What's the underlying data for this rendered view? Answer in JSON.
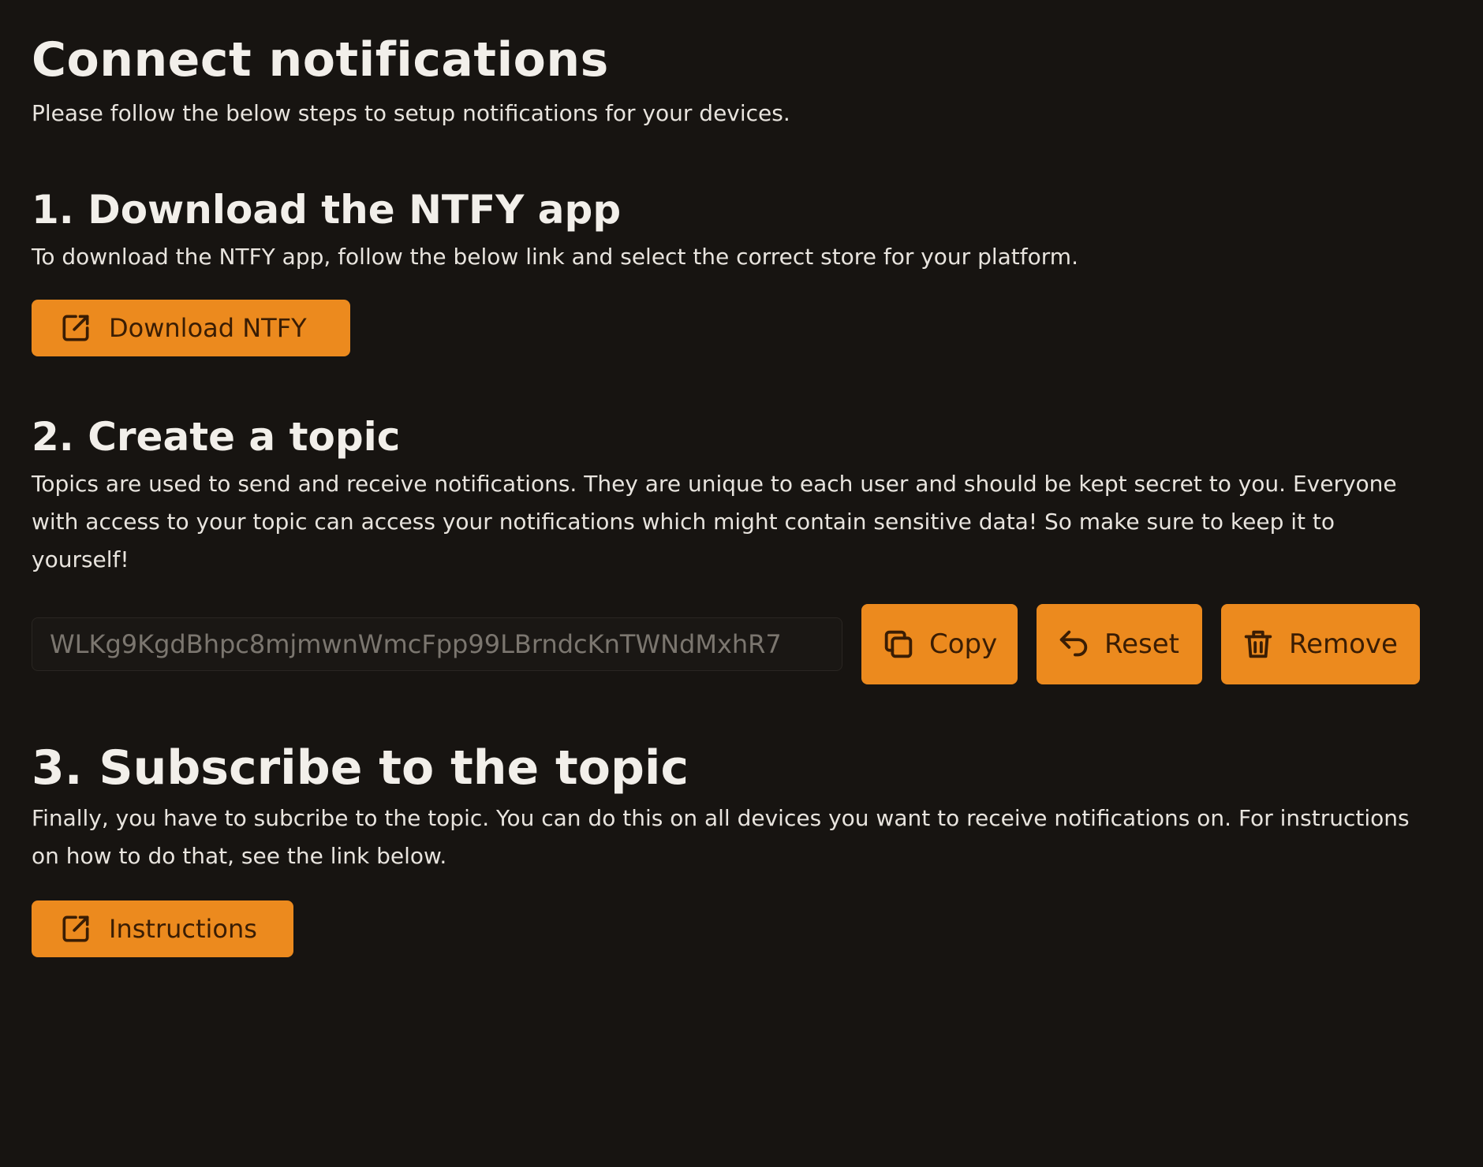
{
  "header": {
    "title": "Connect notifications",
    "subtitle": "Please follow the below steps to setup notifications for your devices."
  },
  "steps": [
    {
      "title": "1. Download the NTFY app",
      "text": "To download the NTFY app, follow the below link and select the correct store for your platform.",
      "button_label": "Download NTFY",
      "button_icon": "external-link-icon"
    },
    {
      "title": "2. Create a topic",
      "text": "Topics are used to send and receive notifications. They are unique to each user and should be kept secret to you. Everyone with access to your topic can access your notifications which might contain sensitive data! So make sure to keep it to yourself!",
      "topic_value": "WLKg9KgdBhpc8mjmwnWmcFpp99LBrndcKnTWNdMxhR7",
      "copy_label": "Copy",
      "reset_label": "Reset",
      "remove_label": "Remove"
    },
    {
      "title": "3. Subscribe to the topic",
      "text": "Finally, you have to subcribe to the topic. You can do this on all devices you want to receive notifications on. For instructions on how to do that, see the link below.",
      "button_label": "Instructions",
      "button_icon": "external-link-icon"
    }
  ],
  "colors": {
    "background": "#171411",
    "accent": "#ec8a1e",
    "button_text": "#3a1d04"
  }
}
